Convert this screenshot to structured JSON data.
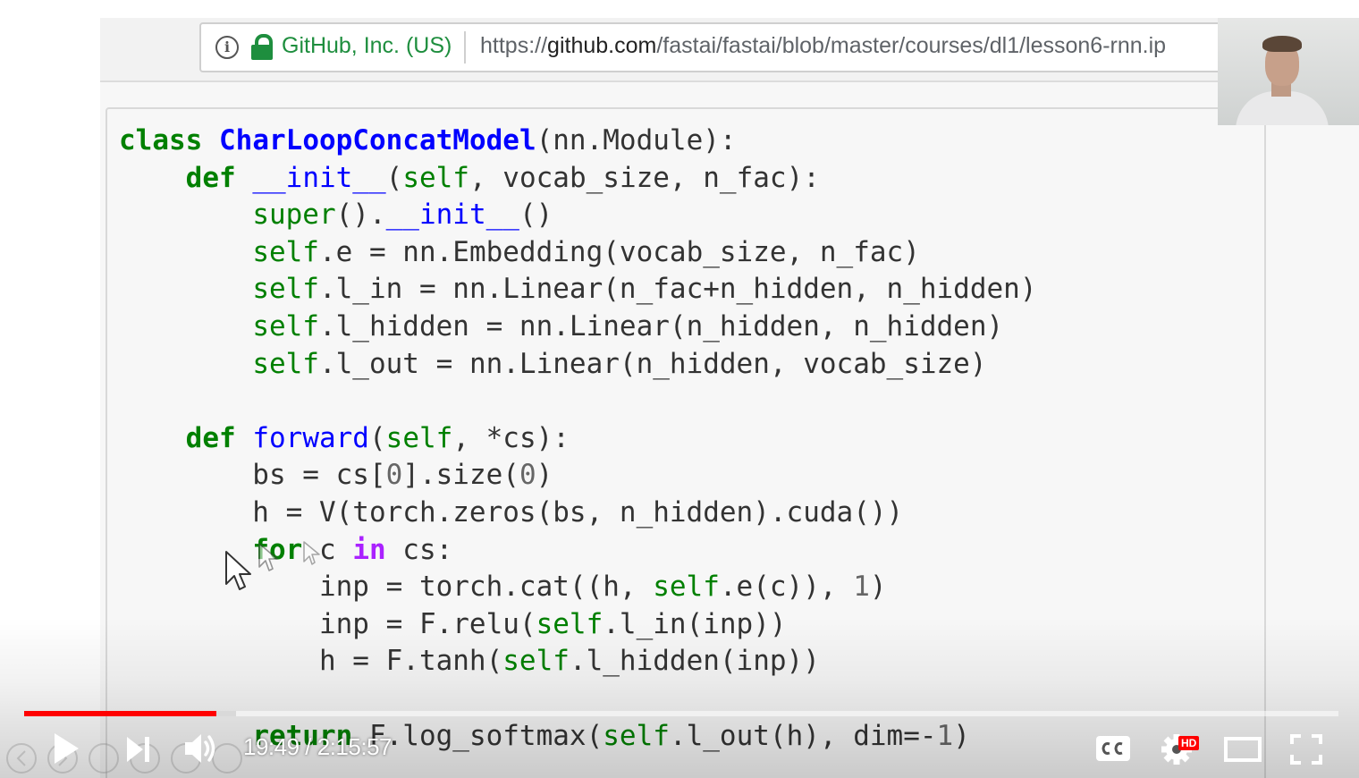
{
  "browser": {
    "site_name": "GitHub, Inc. (US)",
    "url_scheme": "https://",
    "url_domain": "github.com",
    "url_path": "/fastai/fastai/blob/master/courses/dl1/lesson6-rnn.ip"
  },
  "code_lines": [
    [
      {
        "t": "class",
        "c": "kw"
      },
      {
        "t": " "
      },
      {
        "t": "CharLoopConcatModel",
        "c": "cls"
      },
      {
        "t": "(nn.Module):"
      }
    ],
    [
      {
        "t": "    "
      },
      {
        "t": "def",
        "c": "kw"
      },
      {
        "t": " "
      },
      {
        "t": "__init__",
        "c": "fn"
      },
      {
        "t": "("
      },
      {
        "t": "self",
        "c": "bi"
      },
      {
        "t": ", vocab_size, n_fac):"
      }
    ],
    [
      {
        "t": "        "
      },
      {
        "t": "super",
        "c": "bi"
      },
      {
        "t": "()."
      },
      {
        "t": "__init__",
        "c": "fn"
      },
      {
        "t": "()"
      }
    ],
    [
      {
        "t": "        "
      },
      {
        "t": "self",
        "c": "bi"
      },
      {
        "t": ".e = nn.Embedding(vocab_size, n_fac)"
      }
    ],
    [
      {
        "t": "        "
      },
      {
        "t": "self",
        "c": "bi"
      },
      {
        "t": ".l_in = nn.Linear(n_fac+n_hidden, n_hidden)"
      }
    ],
    [
      {
        "t": "        "
      },
      {
        "t": "self",
        "c": "bi"
      },
      {
        "t": ".l_hidden = nn.Linear(n_hidden, n_hidden)"
      }
    ],
    [
      {
        "t": "        "
      },
      {
        "t": "self",
        "c": "bi"
      },
      {
        "t": ".l_out = nn.Linear(n_hidden, vocab_size)"
      }
    ],
    [],
    [
      {
        "t": "    "
      },
      {
        "t": "def",
        "c": "kw"
      },
      {
        "t": " "
      },
      {
        "t": "forward",
        "c": "fn"
      },
      {
        "t": "("
      },
      {
        "t": "self",
        "c": "bi"
      },
      {
        "t": ", *cs):"
      }
    ],
    [
      {
        "t": "        bs = cs["
      },
      {
        "t": "0",
        "c": "num"
      },
      {
        "t": "].size("
      },
      {
        "t": "0",
        "c": "num"
      },
      {
        "t": ")"
      }
    ],
    [
      {
        "t": "        h = V(torch.zeros(bs, n_hidden).cuda())"
      }
    ],
    [
      {
        "t": "        "
      },
      {
        "t": "for",
        "c": "kw"
      },
      {
        "t": " c "
      },
      {
        "t": "in",
        "c": "ow"
      },
      {
        "t": " cs:"
      }
    ],
    [
      {
        "t": "            inp = torch.cat((h, "
      },
      {
        "t": "self",
        "c": "bi"
      },
      {
        "t": ".e(c)), "
      },
      {
        "t": "1",
        "c": "num"
      },
      {
        "t": ")"
      }
    ],
    [
      {
        "t": "            inp = F.relu("
      },
      {
        "t": "self",
        "c": "bi"
      },
      {
        "t": ".l_in(inp))"
      }
    ],
    [
      {
        "t": "            h = F.tanh("
      },
      {
        "t": "self",
        "c": "bi"
      },
      {
        "t": ".l_hidden(inp))"
      }
    ],
    [],
    [
      {
        "t": "        "
      },
      {
        "t": "return",
        "c": "kw"
      },
      {
        "t": " F.log_softmax("
      },
      {
        "t": "self",
        "c": "bi"
      },
      {
        "t": ".l_out(h), dim=-"
      },
      {
        "t": "1",
        "c": "num"
      },
      {
        "t": ")"
      }
    ]
  ],
  "player": {
    "current_time": "19:49",
    "duration": "2:15:57",
    "time_separator": " / ",
    "played_fraction": 0.146,
    "buffered_fraction": 0.161,
    "quality_badge": "HD",
    "icons": {
      "play": "play-icon",
      "next": "next-icon",
      "volume": "volume-icon",
      "captions": "captions-icon",
      "settings": "settings-icon",
      "theater": "theater-icon",
      "fullscreen": "fullscreen-icon"
    },
    "colors": {
      "progress": "#ff0000",
      "badge": "#ff0000"
    }
  }
}
